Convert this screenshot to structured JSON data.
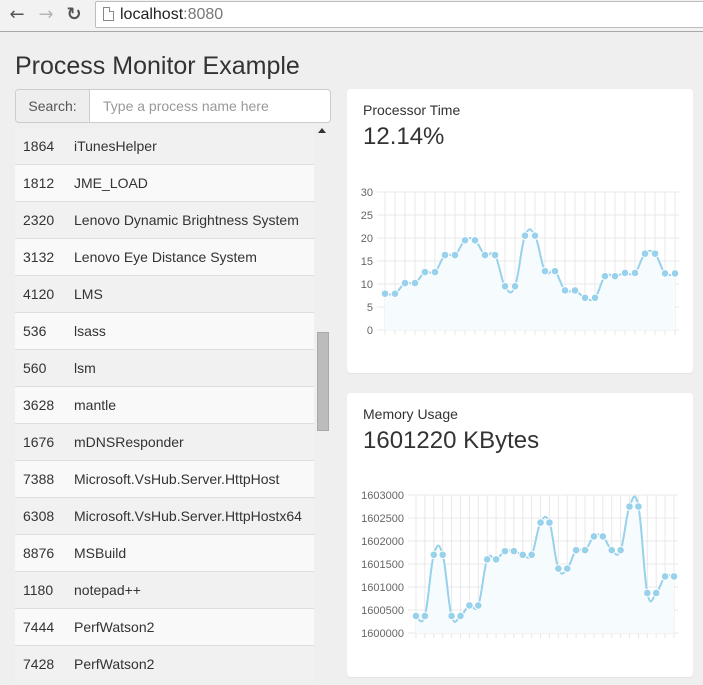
{
  "browser": {
    "url_host": "localhost",
    "url_port": ":8080"
  },
  "page": {
    "title": "Process Monitor Example"
  },
  "search": {
    "label": "Search:",
    "placeholder": "Type a process name here",
    "value": ""
  },
  "processes": [
    {
      "pid": "1864",
      "name": "iTunesHelper"
    },
    {
      "pid": "1812",
      "name": "JME_LOAD"
    },
    {
      "pid": "2320",
      "name": "Lenovo Dynamic Brightness System"
    },
    {
      "pid": "3132",
      "name": "Lenovo Eye Distance System"
    },
    {
      "pid": "4120",
      "name": "LMS"
    },
    {
      "pid": "536",
      "name": "lsass"
    },
    {
      "pid": "560",
      "name": "lsm"
    },
    {
      "pid": "3628",
      "name": "mantle"
    },
    {
      "pid": "1676",
      "name": "mDNSResponder"
    },
    {
      "pid": "7388",
      "name": "Microsoft.VsHub.Server.HttpHost"
    },
    {
      "pid": "6308",
      "name": "Microsoft.VsHub.Server.HttpHostx64"
    },
    {
      "pid": "8876",
      "name": "MSBuild"
    },
    {
      "pid": "1180",
      "name": "notepad++"
    },
    {
      "pid": "7444",
      "name": "PerfWatson2"
    },
    {
      "pid": "7428",
      "name": "PerfWatson2"
    }
  ],
  "scrollbar": {
    "position_fraction": 0.39
  },
  "colors": {
    "line": "#97d1ec",
    "fill": "#f6fbfd",
    "grid": "#e8e8e8"
  },
  "chart_data": [
    {
      "type": "line",
      "title": "Processor Time",
      "current_value": "12.14%",
      "ylim": [
        0,
        30
      ],
      "yticks": [
        "0",
        "5",
        "10",
        "15",
        "20",
        "25",
        "30"
      ],
      "ytick_values": [
        0,
        5,
        10,
        15,
        20,
        25,
        30
      ],
      "grid": true,
      "values": [
        7.9,
        7.9,
        10.2,
        10.2,
        12.6,
        12.6,
        16.3,
        16.3,
        19.5,
        19.5,
        16.3,
        16.3,
        9.5,
        9.5,
        20.5,
        20.5,
        12.8,
        12.8,
        8.6,
        8.6,
        7.0,
        7.0,
        11.7,
        11.7,
        12.4,
        12.4,
        16.6,
        16.6,
        12.3,
        12.3
      ]
    },
    {
      "type": "line",
      "title": "Memory Usage",
      "current_value": "1601220 KBytes",
      "ylim": [
        1600000,
        1603000
      ],
      "yticks": [
        "1600000",
        "1600500",
        "1601000",
        "1601500",
        "1602000",
        "1602500",
        "1603000"
      ],
      "ytick_values": [
        1600000,
        1600500,
        1601000,
        1601500,
        1602000,
        1602500,
        1603000
      ],
      "grid": true,
      "values": [
        1600370,
        1600370,
        1601700,
        1601700,
        1600370,
        1600370,
        1600600,
        1600600,
        1601600,
        1601600,
        1601780,
        1601780,
        1601700,
        1601700,
        1602400,
        1602400,
        1601400,
        1601400,
        1601800,
        1601800,
        1602100,
        1602100,
        1601800,
        1601800,
        1602750,
        1602750,
        1600870,
        1600870,
        1601230,
        1601230
      ]
    }
  ]
}
